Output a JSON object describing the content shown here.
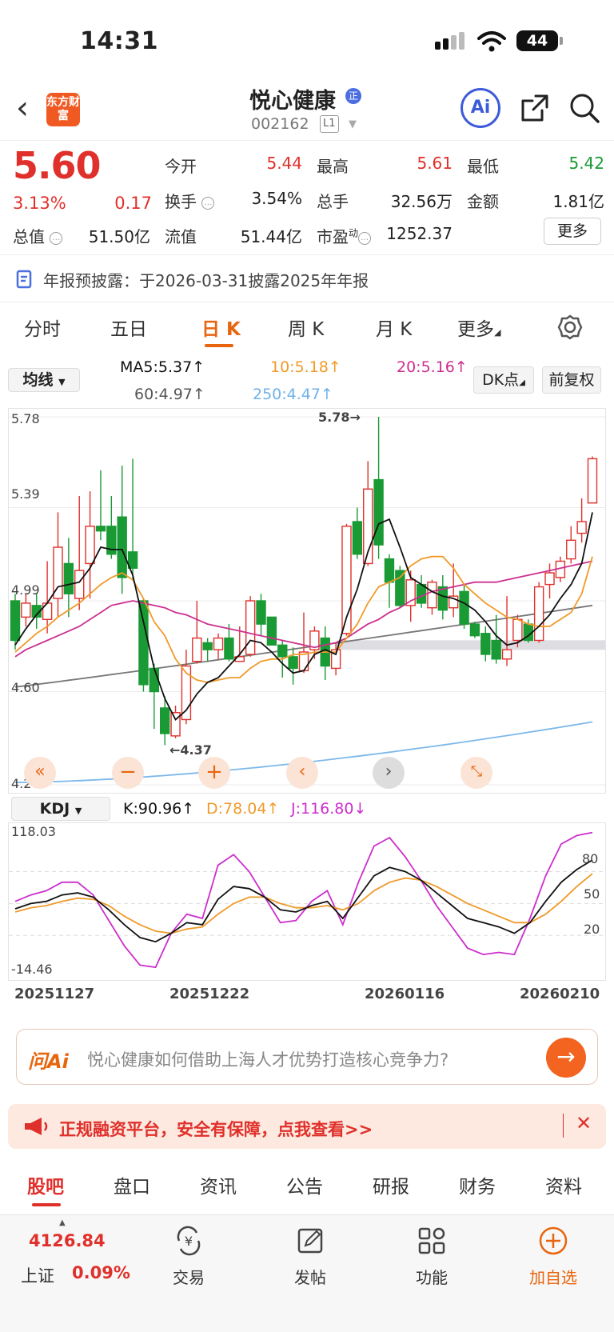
{
  "status": {
    "time": "14:31",
    "battery": "44"
  },
  "header": {
    "logo_text": "东方财富",
    "name": "悦心健康",
    "name_badge": "正",
    "code": "002162",
    "level": "L1"
  },
  "quote": {
    "price": "5.60",
    "change_pct": "3.13%",
    "change": "0.17",
    "open_label": "今开",
    "open": "5.44",
    "high_label": "最高",
    "high": "5.61",
    "low_label": "最低",
    "low": "5.42",
    "turnover_label": "换手",
    "turnover": "3.54%",
    "volume_label": "总手",
    "volume": "32.56万",
    "amount_label": "金额",
    "amount": "1.81亿",
    "mktcap_label": "总值",
    "mktcap": "51.50亿",
    "float_label": "流值",
    "float": "51.44亿",
    "pe_label": "市盈",
    "pe_sup": "动",
    "pe": "1252.37",
    "more": "更多"
  },
  "notice": "年报预披露：于2026-03-31披露2025年年报",
  "period_tabs": [
    "分时",
    "五日",
    "日 K",
    "周 K",
    "月 K",
    "更多"
  ],
  "ma_bar": {
    "selector": "均线",
    "ma5": "MA5:5.37",
    "ma10": "10:5.18",
    "ma20": "20:5.16",
    "ma60": "60:4.97",
    "ma250": "250:4.47",
    "dk": "DK点",
    "fq": "前复权"
  },
  "indicator_bar": {
    "selector": "KDJ",
    "k": "K:90.96",
    "d": "D:78.04",
    "j": "J:116.80"
  },
  "ask_ai": {
    "logo": "问Ai",
    "question": "悦心健康如何借助上海人才优势打造核心竞争力?"
  },
  "ad_text": "正规融资平台，安全有保障，点我查看>>",
  "bottom_tabs": [
    "股吧",
    "盘口",
    "资讯",
    "公告",
    "研报",
    "财务",
    "资料"
  ],
  "dock": {
    "index_value": "4126.84",
    "index_name": "上证",
    "index_change": "0.09%",
    "trade": "交易",
    "post": "发帖",
    "func": "功能",
    "add": "加自选"
  },
  "colors": {
    "up": "#e0302b",
    "down": "#1a9a35",
    "accent": "#e8650d",
    "ma5": "#111111",
    "ma10": "#f09a2a",
    "ma20": "#cc2f8f",
    "ma60": "#777777",
    "ma250": "#7db8ea"
  },
  "chart_data": [
    {
      "type": "candlestick",
      "axis_labels": [
        "5.78",
        "5.39",
        "4.99",
        "4.60",
        "4.20"
      ],
      "ylim": [
        4.2,
        5.78
      ],
      "annotations": {
        "high": "5.78→",
        "low": "←4.37"
      },
      "x_dates": [
        "20251127",
        "20251222",
        "20260116",
        "20260210"
      ],
      "candles": [
        [
          4.99,
          4.82,
          5.02,
          4.78
        ],
        [
          4.92,
          4.98,
          5.02,
          4.88
        ],
        [
          4.97,
          4.92,
          5.02,
          4.87
        ],
        [
          4.91,
          4.98,
          5.16,
          4.85
        ],
        [
          5.0,
          5.22,
          5.37,
          4.92
        ],
        [
          5.15,
          5.02,
          5.26,
          4.92
        ],
        [
          5.0,
          5.12,
          5.44,
          4.95
        ],
        [
          5.15,
          5.31,
          5.46,
          5.0
        ],
        [
          5.31,
          5.29,
          5.55,
          5.25
        ],
        [
          5.31,
          5.19,
          5.44,
          5.17
        ],
        [
          5.35,
          5.09,
          5.57,
          5.02
        ],
        [
          5.2,
          5.13,
          5.6,
          5.08
        ],
        [
          4.99,
          4.63,
          5.0,
          4.6
        ],
        [
          4.7,
          4.6,
          4.72,
          4.44
        ],
        [
          4.53,
          4.42,
          4.58,
          4.37
        ],
        [
          4.41,
          4.51,
          4.54,
          4.4
        ],
        [
          4.48,
          4.71,
          4.78,
          4.46
        ],
        [
          4.73,
          4.83,
          4.99,
          4.72
        ],
        [
          4.81,
          4.78,
          4.83,
          4.73
        ],
        [
          4.78,
          4.83,
          4.85,
          4.74
        ],
        [
          4.83,
          4.74,
          4.89,
          4.73
        ],
        [
          4.73,
          4.75,
          4.88,
          4.73
        ],
        [
          4.76,
          4.99,
          5.01,
          4.75
        ],
        [
          4.99,
          4.89,
          5.02,
          4.84
        ],
        [
          4.92,
          4.8,
          4.92,
          4.8
        ],
        [
          4.8,
          4.75,
          4.82,
          4.66
        ],
        [
          4.75,
          4.7,
          4.79,
          4.63
        ],
        [
          4.69,
          4.77,
          4.94,
          4.68
        ],
        [
          4.78,
          4.86,
          4.88,
          4.74
        ],
        [
          4.83,
          4.71,
          4.88,
          4.65
        ],
        [
          4.7,
          4.78,
          4.81,
          4.67
        ],
        [
          4.85,
          5.31,
          5.32,
          4.84
        ],
        [
          5.33,
          5.19,
          5.39,
          5.17
        ],
        [
          5.15,
          5.47,
          5.59,
          5.14
        ],
        [
          5.51,
          5.23,
          5.78,
          5.17
        ],
        [
          5.17,
          5.07,
          5.19,
          4.96
        ],
        [
          5.12,
          4.97,
          5.14,
          4.96
        ],
        [
          4.97,
          5.08,
          5.12,
          4.9
        ],
        [
          5.06,
          4.98,
          5.1,
          4.96
        ],
        [
          4.96,
          5.07,
          5.08,
          4.93
        ],
        [
          5.05,
          4.95,
          5.1,
          4.91
        ],
        [
          4.96,
          5.01,
          5.15,
          4.92
        ],
        [
          5.03,
          4.89,
          5.06,
          4.87
        ],
        [
          4.89,
          4.84,
          4.9,
          4.83
        ],
        [
          4.85,
          4.76,
          4.88,
          4.73
        ],
        [
          4.82,
          4.74,
          4.93,
          4.72
        ],
        [
          4.74,
          4.78,
          5.01,
          4.71
        ],
        [
          4.82,
          4.91,
          4.93,
          4.79
        ],
        [
          4.89,
          4.82,
          4.91,
          4.81
        ],
        [
          4.82,
          5.05,
          5.07,
          4.81
        ],
        [
          5.06,
          5.11,
          5.15,
          5.0
        ],
        [
          5.09,
          5.16,
          5.18,
          5.07
        ],
        [
          5.17,
          5.25,
          5.31,
          5.15
        ],
        [
          5.28,
          5.33,
          5.43,
          5.24
        ],
        [
          5.41,
          5.6,
          5.61,
          5.42
        ]
      ],
      "ma5": [
        4.8,
        4.87,
        4.93,
        4.98,
        5.05,
        5.06,
        5.07,
        5.13,
        5.22,
        5.21,
        5.21,
        5.1,
        4.9,
        4.7,
        4.57,
        4.48,
        4.52,
        4.59,
        4.64,
        4.66,
        4.71,
        4.76,
        4.82,
        4.81,
        4.77,
        4.72,
        4.68,
        4.69,
        4.76,
        4.78,
        4.76,
        4.92,
        5.04,
        5.2,
        5.32,
        5.34,
        5.22,
        5.09,
        5.06,
        5.03,
        5.01,
        5.0,
        4.98,
        4.95,
        4.9,
        4.84,
        4.8,
        4.81,
        4.84,
        4.88,
        4.93,
        5.0,
        5.06,
        5.15,
        5.37
      ],
      "ma10": [
        4.77,
        4.81,
        4.85,
        4.88,
        4.92,
        4.95,
        4.98,
        5.02,
        5.06,
        5.09,
        5.11,
        5.08,
        5.0,
        4.9,
        4.84,
        4.74,
        4.68,
        4.65,
        4.64,
        4.65,
        4.66,
        4.66,
        4.7,
        4.73,
        4.74,
        4.74,
        4.76,
        4.76,
        4.77,
        4.77,
        4.77,
        4.83,
        4.89,
        4.98,
        5.05,
        5.07,
        5.09,
        5.14,
        5.17,
        5.18,
        5.18,
        5.13,
        5.06,
        5.02,
        4.98,
        4.95,
        4.92,
        4.91,
        4.89,
        4.88,
        4.88,
        4.91,
        4.94,
        5.02,
        5.18
      ],
      "ma20": [
        4.75,
        4.78,
        4.8,
        4.82,
        4.84,
        4.86,
        4.88,
        4.91,
        4.94,
        4.97,
        4.98,
        4.99,
        4.98,
        4.97,
        4.96,
        4.94,
        4.93,
        4.91,
        4.89,
        4.88,
        4.87,
        4.86,
        4.85,
        4.84,
        4.83,
        4.82,
        4.81,
        4.8,
        4.79,
        4.8,
        4.81,
        4.83,
        4.86,
        4.89,
        4.91,
        4.94,
        4.96,
        4.99,
        5.01,
        5.03,
        5.04,
        5.05,
        5.06,
        5.07,
        5.07,
        5.07,
        5.08,
        5.09,
        5.1,
        5.11,
        5.12,
        5.13,
        5.14,
        5.15,
        5.16
      ]
    },
    {
      "type": "line",
      "axis_labels": [
        "118.03",
        "80",
        "50",
        "20",
        "-14.46"
      ],
      "ylim": [
        -14.46,
        118.03
      ],
      "k": [
        45,
        50,
        52,
        58,
        60,
        56,
        44,
        30,
        18,
        14,
        22,
        32,
        30,
        54,
        66,
        64,
        56,
        44,
        42,
        48,
        52,
        36,
        56,
        76,
        84,
        80,
        72,
        60,
        48,
        36,
        32,
        28,
        22,
        32,
        52,
        70,
        82,
        90.96
      ],
      "d": [
        42,
        46,
        48,
        52,
        55,
        54,
        48,
        38,
        30,
        24,
        22,
        26,
        28,
        40,
        50,
        56,
        56,
        50,
        46,
        46,
        48,
        44,
        50,
        62,
        70,
        74,
        72,
        66,
        58,
        50,
        44,
        38,
        32,
        32,
        40,
        52,
        66,
        78.04
      ],
      "j": [
        52,
        58,
        62,
        70,
        70,
        58,
        34,
        10,
        -8,
        -10,
        22,
        40,
        36,
        86,
        96,
        80,
        56,
        32,
        34,
        52,
        62,
        30,
        70,
        104,
        112,
        94,
        72,
        48,
        28,
        8,
        2,
        4,
        2,
        36,
        76,
        106,
        114,
        116.8
      ]
    }
  ]
}
